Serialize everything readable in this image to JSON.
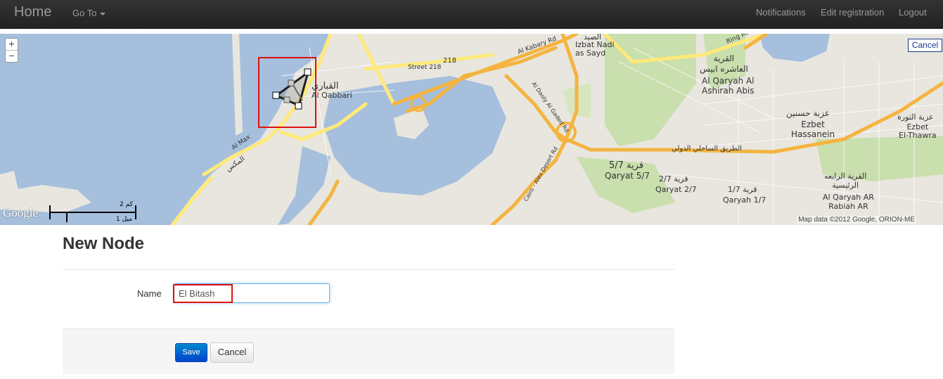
{
  "navbar": {
    "brand": "Home",
    "goto_label": "Go To",
    "notifications": "Notifications",
    "edit_registration": "Edit registration",
    "logout": "Logout"
  },
  "map": {
    "zoom_in": "+",
    "zoom_out": "−",
    "cancel_label": "Cancel",
    "google_logo": "Google",
    "attribution": "Map data ©2012 Google, ORION-ME",
    "scale_top": "2 كم",
    "scale_bottom": "1 ميل",
    "labels": {
      "qabbari_ar": "القباري",
      "qabbari_en": "Al Qabbari",
      "street_218": "Street 218",
      "road_218": "218",
      "al_kabary_rd": "Al Kabary Rd",
      "izbat_ar": "الصيد",
      "izbat_en": "Izbat Nadi\nas Sayd",
      "qaryah_abis_ar": "القرية\nالعاشره ابيس",
      "qaryah_abis_en": "Al Qaryah Al\nAshirah Abis",
      "hassanein_ar": "عزبة حسنين",
      "hassanein_en": "Ezbet\nHassanein",
      "thawra_ar": "عزبة الثورة",
      "thawra_en": "Ezbet\nEl-Thawra",
      "qaryat57_ar": "قرية 5/7",
      "qaryat57_en": "Qaryat 5/7",
      "qaryat27_ar": "قرية 2/7",
      "qaryat27_en": "Qaryat 2/7",
      "qaryah17_ar": "قرية 1/7",
      "qaryah17_en": "Qaryah 1/7",
      "rabiah_ar": "القرية الرابعه\nالرئيسية",
      "rabiah_en": "Al Qaryah AR\nRabiah AR",
      "al_max": "Al Max",
      "al_mex_ar": "المكس",
      "al_gaded_rd": "Al Daoly Al Gaded Rd",
      "cairo_alex": "Cairo - Alex Desert Rd",
      "coastal_ar": "الطريق الساحلي الدولي",
      "ring_rd": "Ring Rd"
    }
  },
  "form": {
    "title": "New Node",
    "name_label": "Name",
    "name_value": "El Bitash",
    "save_label": "Save",
    "cancel_label": "Cancel"
  },
  "colors": {
    "water": "#a5bfdd",
    "land": "#e8e6df",
    "road_major": "#f4b43f",
    "road_minor": "#ffe97a",
    "park": "#c9dfae",
    "highlight": "#dd1111",
    "save_button": "#0066cc"
  }
}
